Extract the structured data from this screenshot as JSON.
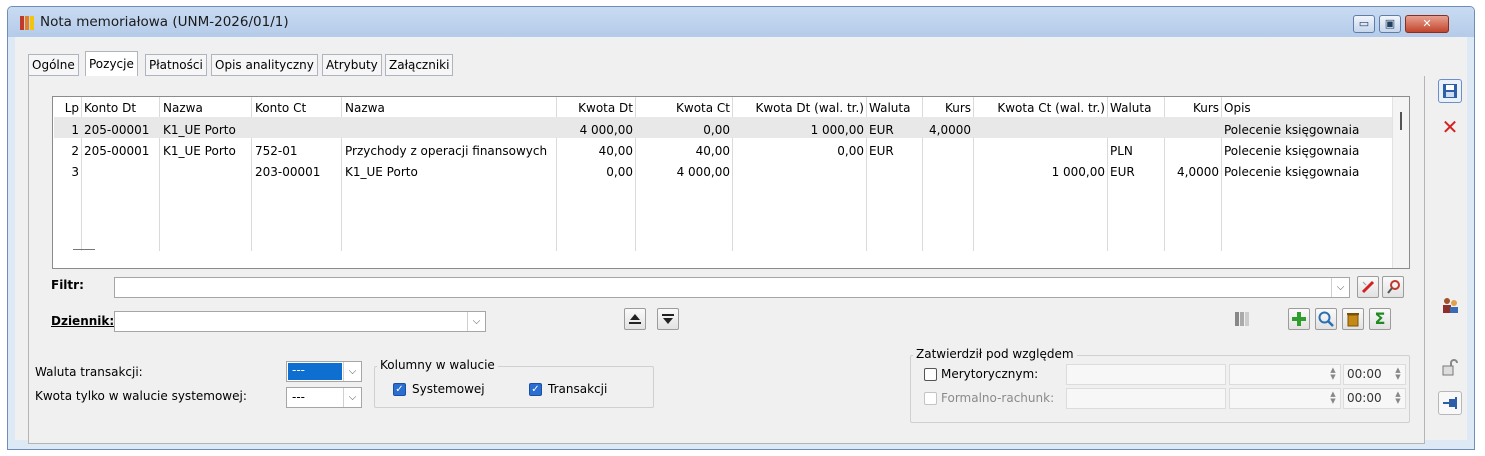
{
  "window": {
    "title": "Nota memoriałowa (UNM-2026/01/1)",
    "btn_min": "▭",
    "btn_max": "▣",
    "btn_close": "✕"
  },
  "tabs": [
    "Ogólne",
    "Pozycje",
    "Płatności",
    "Opis analityczny",
    "Atrybuty",
    "Załączniki"
  ],
  "grid": {
    "headers": [
      "Lp",
      "Konto Dt",
      "Nazwa",
      "Konto Ct",
      "Nazwa",
      "Kwota Dt",
      "Kwota Ct",
      "Kwota Dt (wal. tr.)",
      "Waluta",
      "Kurs",
      "Kwota Ct (wal. tr.)",
      "Waluta",
      "Kurs",
      "Opis"
    ],
    "rows": [
      [
        "1",
        "205-00001",
        "K1_UE Porto",
        "",
        "",
        "4 000,00",
        "0,00",
        "1 000,00",
        "EUR",
        "4,0000",
        "",
        "",
        "",
        "Polecenie księgownaia"
      ],
      [
        "2",
        "205-00001",
        "K1_UE Porto",
        "752-01",
        "Przychody z operacji finansowych",
        "40,00",
        "40,00",
        "0,00",
        "EUR",
        "",
        "",
        "PLN",
        "",
        "Polecenie księgownaia"
      ],
      [
        "3",
        "",
        "",
        "203-00001",
        "K1_UE Porto",
        "0,00",
        "4 000,00",
        "",
        "",
        "",
        "1 000,00",
        "EUR",
        "4,0000",
        "Polecenie księgownaia"
      ]
    ]
  },
  "filter": {
    "label": "Filtr:",
    "value": ""
  },
  "journal": {
    "label": "Dziennik:",
    "value": ""
  },
  "currency": {
    "transaction_label": "Waluta transakcji:",
    "transaction_value": "---",
    "system_only_label": "Kwota tylko w walucie systemowej:",
    "system_only_value": "---"
  },
  "columns_group": {
    "title": "Kolumny w walucie",
    "systemowej": "Systemowej",
    "transakcji": "Transakcji"
  },
  "approval": {
    "title": "Zatwierdził pod względem",
    "merytoryczny": "Merytorycznym:",
    "formalny": "Formalno-rachunk:",
    "time1": "00:00",
    "time2": "00:00"
  },
  "icons": {
    "save": "save-icon",
    "cancel": "close-icon",
    "filter_clear": "clear-filter-icon",
    "filter_advanced": "advanced-filter-icon",
    "move_up": "move-up-icon",
    "move_down": "move-down-icon",
    "columns": "columns-icon",
    "add": "plus-icon",
    "preview": "magnifier-icon",
    "delete": "trash-icon",
    "sum": "sigma-icon",
    "users": "users-icon",
    "lock": "lock-icon",
    "pin": "pin-icon"
  },
  "colors": {
    "accent": "#2b6ed1",
    "add": "#2f9e2f",
    "delete": "#d42020",
    "sum": "#1f8a1f"
  }
}
